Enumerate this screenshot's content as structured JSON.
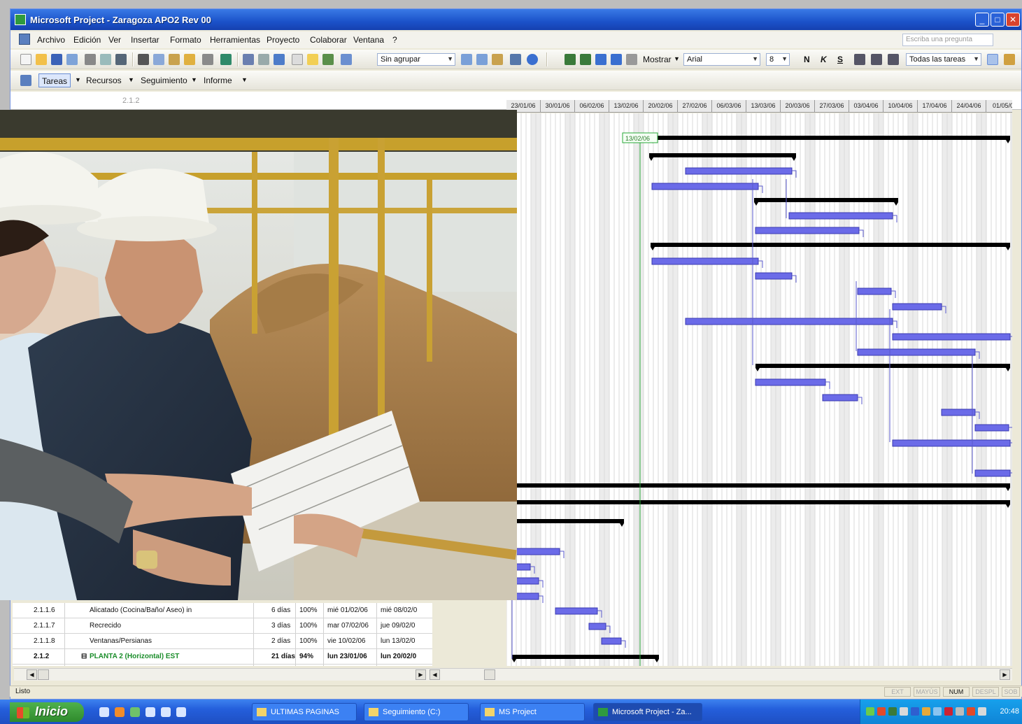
{
  "window": {
    "title": "Microsoft Project - Zaragoza APO2 Rev 00",
    "min": "_",
    "max": "□",
    "close": "✕"
  },
  "menu": {
    "items": [
      "Archivo",
      "Edición",
      "Ver",
      "Insertar",
      "Formato",
      "Herramientas",
      "Proyecto",
      "Colaborar",
      "Ventana",
      "?"
    ],
    "ask_placeholder": "Escriba una pregunta"
  },
  "toolbar": {
    "group_dropdown": "Sin agrupar",
    "show_label": "Mostrar",
    "font_dropdown": "Arial",
    "size_dropdown": "8",
    "bold": "N",
    "italic": "K",
    "underline": "S",
    "filter_dropdown": "Todas las tareas"
  },
  "views": {
    "tasks": "Tareas",
    "resources": "Recursos",
    "tracking": "Seguimiento",
    "report": "Informe"
  },
  "entry_bar": {
    "value": "2.1.2"
  },
  "timescale": [
    "23/01/06",
    "30/01/06",
    "06/02/06",
    "13/02/06",
    "20/02/06",
    "27/02/06",
    "06/03/06",
    "13/03/06",
    "20/03/06",
    "27/03/06",
    "03/04/06",
    "10/04/06",
    "17/04/06",
    "24/04/06",
    "01/05/0"
  ],
  "gantt": {
    "today_marker": "13/02/06"
  },
  "tasks": [
    {
      "id": "2.1.1.6",
      "name": "Alicatado (Cocina/Baño/ Aseo) in",
      "duration": "6 días",
      "complete": "100%",
      "start": "mié 01/02/06",
      "finish": "mié 08/02/0",
      "summary": false
    },
    {
      "id": "2.1.1.7",
      "name": "Recrecido",
      "duration": "3 días",
      "complete": "100%",
      "start": "mar 07/02/06",
      "finish": "jue 09/02/0",
      "summary": false
    },
    {
      "id": "2.1.1.8",
      "name": "Ventanas/Persianas",
      "duration": "2 días",
      "complete": "100%",
      "start": "vie 10/02/06",
      "finish": "lun 13/02/0",
      "summary": false
    },
    {
      "id": "2.1.2",
      "name": "PLANTA 2 (Horizontal) EST",
      "duration": "21 días",
      "complete": "94%",
      "start": "lun 23/01/06",
      "finish": "lun 20/02/0",
      "summary": true
    }
  ],
  "status": {
    "ready": "Listo",
    "indicators": [
      "EXT",
      "MAYÚS",
      "NUM",
      "DESPL",
      "SOB"
    ],
    "active_indicator": "NUM"
  },
  "taskbar": {
    "start": "Inicio",
    "items": [
      "ULTIMAS PAGINAS",
      "Seguimiento (C:)",
      "MS Project",
      "Microsoft Project - Za..."
    ],
    "clock": "20:48"
  },
  "colors": {
    "titlebar": "#1b52c9",
    "task_bar": "#6b6be8",
    "summary_bar": "#000000",
    "today_line": "#2aa83a",
    "taskbar": "#245edb"
  }
}
